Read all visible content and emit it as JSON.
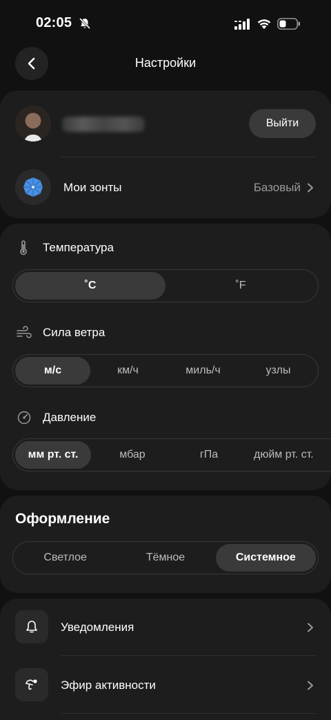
{
  "status": {
    "time": "02:05"
  },
  "header": {
    "title": "Настройки"
  },
  "account": {
    "logout_label": "Выйти"
  },
  "umbrellas": {
    "label": "Мои зонты",
    "value": "Базовый"
  },
  "temperature": {
    "label": "Температура",
    "options": [
      "˚C",
      "˚F"
    ],
    "selected": "˚C"
  },
  "wind": {
    "label": "Сила ветра",
    "options": [
      "м/с",
      "км/ч",
      "миль/ч",
      "узлы"
    ],
    "selected": "м/с"
  },
  "pressure": {
    "label": "Давление",
    "options": [
      "мм рт. ст.",
      "мбар",
      "гПа",
      "дюйм рт. ст."
    ],
    "selected": "мм рт. ст."
  },
  "theme": {
    "title": "Оформление",
    "options": [
      "Светлое",
      "Тёмное",
      "Системное"
    ],
    "selected": "Системное"
  },
  "menu": {
    "items": [
      {
        "label": "Уведомления",
        "icon": "bell-icon"
      },
      {
        "label": "Эфир активности",
        "icon": "activity-icon"
      }
    ]
  },
  "colors": {
    "background": "#111111",
    "card": "#1d1d1d",
    "active_segment": "#3a3a3a",
    "accent_umbrella": "#4a90e2"
  }
}
